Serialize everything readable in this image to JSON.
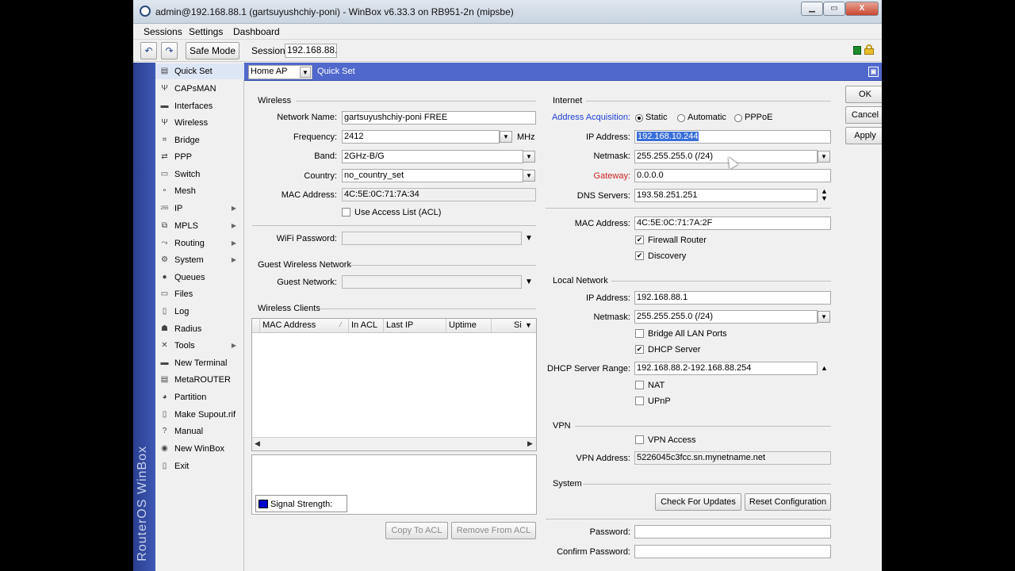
{
  "window": {
    "title": "admin@192.168.88.1 (gartsuyushchiy-poni) - WinBox v6.33.3 on RB951-2n (mipsbe)",
    "minimize_icon": "minimize-icon",
    "maximize_icon": "maximize-icon",
    "close_label": "X"
  },
  "menu": {
    "sessions": "Sessions",
    "settings": "Settings",
    "dashboard": "Dashboard"
  },
  "toolbar": {
    "safe_mode": "Safe Mode",
    "session_label": "Session:",
    "session_value": "192.168.88.1"
  },
  "sidebar": {
    "brand": "RouterOS WinBox",
    "items": [
      {
        "label": "Quick Set",
        "icon": "quickset-icon",
        "glyph": "▤",
        "submenu": false
      },
      {
        "label": "CAPsMAN",
        "icon": "antenna-icon",
        "glyph": "Ψ",
        "submenu": false
      },
      {
        "label": "Interfaces",
        "icon": "interfaces-icon",
        "glyph": "▬",
        "submenu": false
      },
      {
        "label": "Wireless",
        "icon": "wireless-icon",
        "glyph": "Ψ",
        "submenu": false
      },
      {
        "label": "Bridge",
        "icon": "bridge-icon",
        "glyph": "⌗",
        "submenu": false
      },
      {
        "label": "PPP",
        "icon": "ppp-icon",
        "glyph": "⇄",
        "submenu": false
      },
      {
        "label": "Switch",
        "icon": "switch-icon",
        "glyph": "▭",
        "submenu": false
      },
      {
        "label": "Mesh",
        "icon": "mesh-icon",
        "glyph": "∘",
        "submenu": false
      },
      {
        "label": "IP",
        "icon": "ip-icon",
        "glyph": "255",
        "submenu": true
      },
      {
        "label": "MPLS",
        "icon": "mpls-icon",
        "glyph": "⧉",
        "submenu": true
      },
      {
        "label": "Routing",
        "icon": "routing-icon",
        "glyph": "⤳",
        "submenu": true
      },
      {
        "label": "System",
        "icon": "gear-icon",
        "glyph": "⚙",
        "submenu": true
      },
      {
        "label": "Queues",
        "icon": "queues-icon",
        "glyph": "●",
        "submenu": false
      },
      {
        "label": "Files",
        "icon": "folder-icon",
        "glyph": "▭",
        "submenu": false
      },
      {
        "label": "Log",
        "icon": "log-icon",
        "glyph": "▯",
        "submenu": false
      },
      {
        "label": "Radius",
        "icon": "radius-icon",
        "glyph": "☗",
        "submenu": false
      },
      {
        "label": "Tools",
        "icon": "tools-icon",
        "glyph": "✕",
        "submenu": true
      },
      {
        "label": "New Terminal",
        "icon": "terminal-icon",
        "glyph": "▬",
        "submenu": false
      },
      {
        "label": "MetaROUTER",
        "icon": "metarouter-icon",
        "glyph": "▤",
        "submenu": false
      },
      {
        "label": "Partition",
        "icon": "partition-icon",
        "glyph": "◕",
        "submenu": false
      },
      {
        "label": "Make Supout.rif",
        "icon": "supout-icon",
        "glyph": "▯",
        "submenu": false
      },
      {
        "label": "Manual",
        "icon": "help-icon",
        "glyph": "?",
        "submenu": false
      },
      {
        "label": "New WinBox",
        "icon": "winbox-icon",
        "glyph": "◉",
        "submenu": false
      },
      {
        "label": "Exit",
        "icon": "exit-icon",
        "glyph": "▯",
        "submenu": false
      }
    ]
  },
  "quickset": {
    "mode": "Home AP",
    "title": "Quick Set"
  },
  "wireless": {
    "group": "Wireless",
    "network_name_label": "Network Name:",
    "network_name": "gartsuyushchiy-poni FREE",
    "frequency_label": "Frequency:",
    "frequency": "2412",
    "frequency_unit": "MHz",
    "band_label": "Band:",
    "band": "2GHz-B/G",
    "country_label": "Country:",
    "country": "no_country_set",
    "mac_label": "MAC Address:",
    "mac": "4C:5E:0C:71:7A:34",
    "use_acl": "Use Access List (ACL)",
    "wifi_password_label": "WiFi Password:",
    "wifi_password": ""
  },
  "guest": {
    "group": "Guest Wireless Network",
    "label": "Guest Network:",
    "value": ""
  },
  "clients": {
    "group": "Wireless Clients",
    "columns": [
      "MAC Address",
      "In ACL",
      "Last IP",
      "Uptime",
      "Sig"
    ],
    "signal_label": "Signal Strength:",
    "signal_color": "#0000cc",
    "copy_to_acl": "Copy To ACL",
    "remove_from_acl": "Remove From ACL"
  },
  "internet": {
    "group": "Internet",
    "acquisition_label": "Address Acquisition:",
    "static": "Static",
    "automatic": "Automatic",
    "pppoe": "PPPoE",
    "ip_label": "IP Address:",
    "ip": "192.168.10.244",
    "netmask_label": "Netmask:",
    "netmask": "255.255.255.0 (/24)",
    "gateway_label": "Gateway:",
    "gateway": "0.0.0.0",
    "dns_label": "DNS Servers:",
    "dns": "193.58.251.251",
    "mac_label": "MAC Address:",
    "mac": "4C:5E:0C:71:7A:2F",
    "firewall": "Firewall Router",
    "discovery": "Discovery"
  },
  "local": {
    "group": "Local Network",
    "ip_label": "IP Address:",
    "ip": "192.168.88.1",
    "netmask_label": "Netmask:",
    "netmask": "255.255.255.0 (/24)",
    "bridge_all": "Bridge All LAN Ports",
    "dhcp_server": "DHCP Server",
    "dhcp_range_label": "DHCP Server Range:",
    "dhcp_range": "192.168.88.2-192.168.88.254",
    "nat": "NAT",
    "upnp": "UPnP"
  },
  "vpn": {
    "group": "VPN",
    "access": "VPN Access",
    "address_label": "VPN Address:",
    "address": "5226045c3fcc.sn.mynetname.net"
  },
  "system": {
    "group": "System",
    "check_updates": "Check For Updates",
    "reset_config": "Reset Configuration",
    "password_label": "Password:",
    "confirm_label": "Confirm Password:"
  },
  "actions": {
    "ok": "OK",
    "cancel": "Cancel",
    "apply": "Apply"
  },
  "colors": {
    "accent_blue": "#5068cc",
    "label_blue": "#1f3fd6",
    "label_red": "#cc2222",
    "selection": "#3a6fd8"
  }
}
